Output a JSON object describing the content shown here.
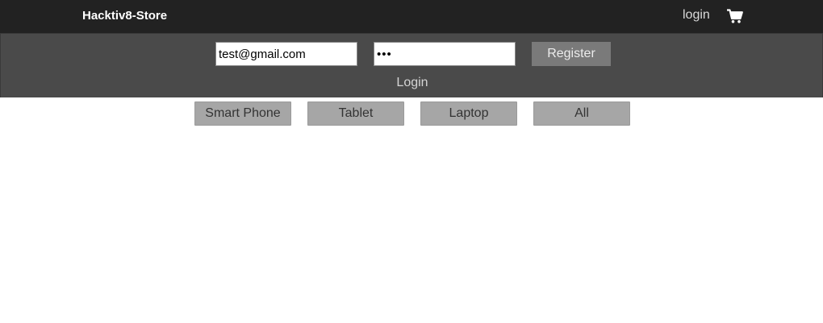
{
  "navbar": {
    "brand": "Hacktiv8-Store",
    "login_label": "login",
    "cart_icon": "shopping-cart-icon"
  },
  "login_form": {
    "email_value": "test@gmail.com",
    "password_value": "•••",
    "register_label": "Register",
    "login_label": "Login"
  },
  "categories": [
    {
      "label": "Smart Phone"
    },
    {
      "label": "Tablet"
    },
    {
      "label": "Laptop"
    },
    {
      "label": "All"
    }
  ],
  "colors": {
    "navbar_bg": "#222222",
    "panel_bg": "#4a4a4a",
    "register_bg": "#7a7a7a",
    "category_bg": "#a6a6a6"
  }
}
